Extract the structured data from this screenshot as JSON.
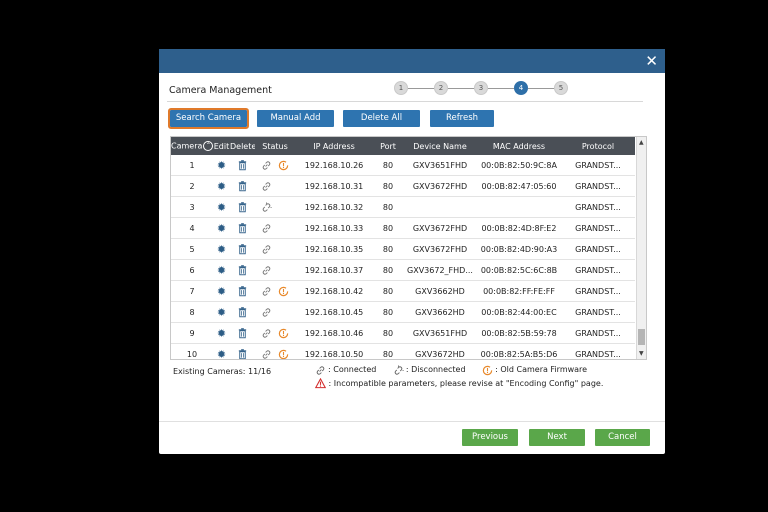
{
  "dialog": {
    "title": "Camera Management",
    "steps": [
      "1",
      "2",
      "3",
      "4",
      "5"
    ],
    "active_step": "4"
  },
  "toolbar": {
    "search_label": "Search Camera",
    "manual_label": "Manual Add",
    "delete_all_label": "Delete All",
    "refresh_label": "Refresh"
  },
  "table": {
    "headers": [
      "Camera",
      "Edit",
      "Delete",
      "Status",
      "IP Address",
      "Port",
      "Device Name",
      "MAC Address",
      "Protocol"
    ],
    "rows": [
      {
        "camera": "1",
        "status": "connected",
        "warn": true,
        "ip": "192.168.10.26",
        "port": "80",
        "device": "GXV3651FHD",
        "mac": "00:0B:82:50:9C:8A",
        "protocol": "GRANDST..."
      },
      {
        "camera": "2",
        "status": "connected",
        "warn": false,
        "ip": "192.168.10.31",
        "port": "80",
        "device": "GXV3672FHD",
        "mac": "00:0B:82:47:05:60",
        "protocol": "GRANDST..."
      },
      {
        "camera": "3",
        "status": "disconnected",
        "warn": false,
        "ip": "192.168.10.32",
        "port": "80",
        "device": "",
        "mac": "",
        "protocol": "GRANDST..."
      },
      {
        "camera": "4",
        "status": "connected",
        "warn": false,
        "ip": "192.168.10.33",
        "port": "80",
        "device": "GXV3672FHD",
        "mac": "00:0B:82:4D:8F:E2",
        "protocol": "GRANDST..."
      },
      {
        "camera": "5",
        "status": "connected",
        "warn": false,
        "ip": "192.168.10.35",
        "port": "80",
        "device": "GXV3672FHD",
        "mac": "00:0B:82:4D:90:A3",
        "protocol": "GRANDST..."
      },
      {
        "camera": "6",
        "status": "connected",
        "warn": false,
        "ip": "192.168.10.37",
        "port": "80",
        "device": "GXV3672_FHD...",
        "mac": "00:0B:82:5C:6C:8B",
        "protocol": "GRANDST..."
      },
      {
        "camera": "7",
        "status": "connected",
        "warn": true,
        "ip": "192.168.10.42",
        "port": "80",
        "device": "GXV3662HD",
        "mac": "00:0B:82:FF:FE:FF",
        "protocol": "GRANDST..."
      },
      {
        "camera": "8",
        "status": "connected",
        "warn": false,
        "ip": "192.168.10.45",
        "port": "80",
        "device": "GXV3662HD",
        "mac": "00:0B:82:44:00:EC",
        "protocol": "GRANDST..."
      },
      {
        "camera": "9",
        "status": "connected",
        "warn": true,
        "ip": "192.168.10.46",
        "port": "80",
        "device": "GXV3651FHD",
        "mac": "00:0B:82:5B:59:78",
        "protocol": "GRANDST..."
      },
      {
        "camera": "10",
        "status": "connected",
        "warn": true,
        "ip": "192.168.10.50",
        "port": "80",
        "device": "GXV3672HD",
        "mac": "00:0B:82:5A:B5:D6",
        "protocol": "GRANDST..."
      }
    ]
  },
  "footer": {
    "existing_label": "Existing Cameras:",
    "existing_value": "11/16",
    "legend_connected": ": Connected",
    "legend_disconnected": ": Disconnected",
    "legend_old_firmware": ": Old Camera Firmware",
    "legend_incompatible": ": Incompatible parameters, please revise at \"Encoding Config\" page."
  },
  "nav": {
    "previous_label": "Previous",
    "next_label": "Next",
    "cancel_label": "Cancel"
  },
  "colors": {
    "titlebar": "#2e5f8c",
    "button_blue": "#2e74b0",
    "button_green": "#5aa74a",
    "warn_orange": "#e8892b",
    "gear_blue": "#2d5d86"
  },
  "icons": {
    "edit": "gear-icon",
    "delete": "trash-icon",
    "connected": "link-icon",
    "disconnected": "broken-link-icon",
    "old_firmware": "warning-circle-icon",
    "incompatible": "warning-triangle-icon",
    "close": "close-icon"
  }
}
